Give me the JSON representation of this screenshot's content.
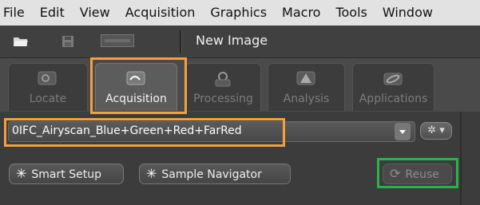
{
  "menu": [
    "File",
    "Edit",
    "View",
    "Acquisition",
    "Graphics",
    "Macro",
    "Tools",
    "Window"
  ],
  "toolbar": {
    "open_icon": "folder-open-icon",
    "save_icon": "save-icon",
    "image_document_name": "New Image"
  },
  "tabs": [
    {
      "label": "Locate",
      "icon": "locate-icon",
      "active": false
    },
    {
      "label": "Acquisition",
      "icon": "acquisition-icon",
      "active": true
    },
    {
      "label": "Processing",
      "icon": "processing-icon",
      "active": false
    },
    {
      "label": "Analysis",
      "icon": "analysis-icon",
      "active": false
    },
    {
      "label": "Applications",
      "icon": "applications-icon",
      "active": false
    }
  ],
  "experiment": {
    "selected": "0IFC_Airyscan_Blue+Green+Red+FarRed",
    "options_icon": "gear-icon"
  },
  "buttons": {
    "smart_setup": "Smart Setup",
    "sample_navigator": "Sample Navigator",
    "reuse": "Reuse"
  },
  "colors": {
    "highlight_orange": "#f5a03a",
    "highlight_green": "#27b34a",
    "active_tab": "#5c5c5c"
  }
}
